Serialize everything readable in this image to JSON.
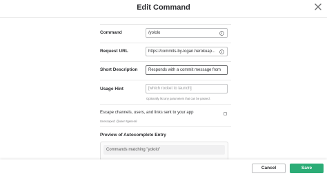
{
  "dialog": {
    "title": "Edit Command"
  },
  "fields": {
    "command": {
      "label": "Command",
      "value": "/yololo"
    },
    "request_url": {
      "label": "Request URL",
      "value": "https://commits-by-logan.herokuap..."
    },
    "short_description": {
      "label": "Short Description",
      "value": "Responds with a commit message from"
    },
    "usage_hint": {
      "label": "Usage Hint",
      "placeholder": "[which rocket to launch]",
      "help": "Optionally list any parameters that can be passed."
    }
  },
  "escape": {
    "label": "Escape channels, users, and links sent to your app",
    "unescaped_text": "Unescaped: @user #general",
    "checked": false
  },
  "preview": {
    "label": "Preview of Autocomplete Entry",
    "matching_text": "Commands matching \"yololo\""
  },
  "footer": {
    "cancel_label": "Cancel",
    "save_label": "Save"
  },
  "colors": {
    "save_button": "#2bac76",
    "text": "#2c2d30"
  },
  "icons": {
    "close": "close-icon",
    "info": "info-icon"
  }
}
